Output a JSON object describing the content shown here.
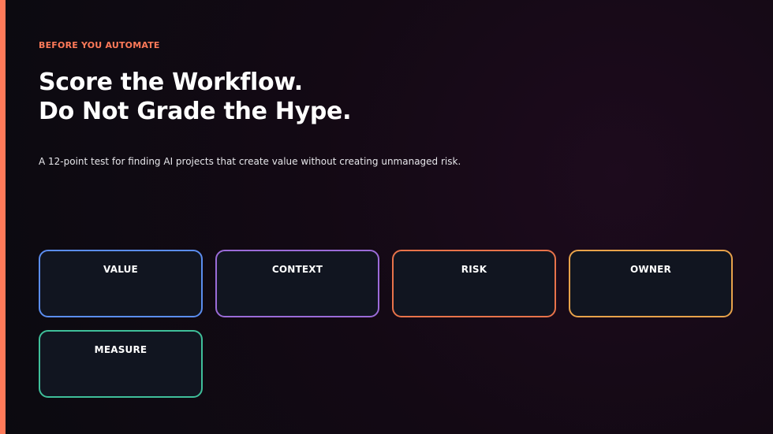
{
  "slide": {
    "eyebrow": "BEFORE YOU AUTOMATE",
    "title_line1": "Score the Workflow.",
    "title_line2": "Do Not Grade the Hype.",
    "subtitle": "A 12-point test for finding AI projects that create value without creating unmanaged risk."
  },
  "colors": {
    "accent": "#ff7a59",
    "card_background": "#111520"
  },
  "cards": [
    {
      "label": "VALUE",
      "border": "#5b8def"
    },
    {
      "label": "CONTEXT",
      "border": "#9b6bd8"
    },
    {
      "label": "RISK",
      "border": "#e8734a"
    },
    {
      "label": "OWNER",
      "border": "#e8a24a"
    },
    {
      "label": "MEASURE",
      "border": "#3fbf9a"
    }
  ]
}
